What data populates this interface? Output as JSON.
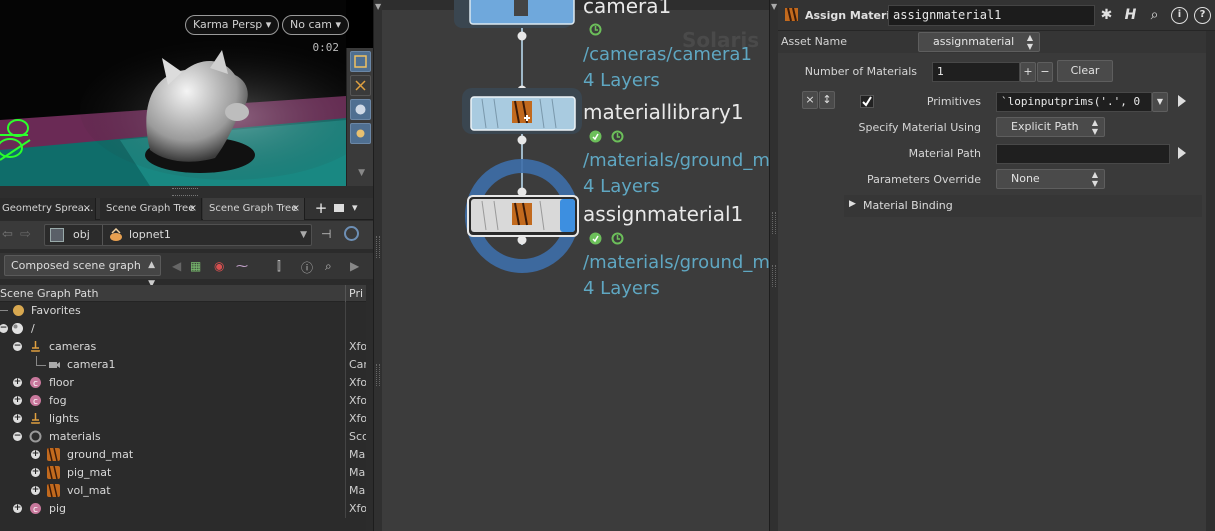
{
  "viewport": {
    "camera_menu": "Karma Persp",
    "cam_menu": "No cam",
    "time_readout": "0:02"
  },
  "tabs": [
    {
      "label": "Geometry Sprea...",
      "active": false
    },
    {
      "label": "Scene Graph Tree",
      "active": false
    },
    {
      "label": "Scene Graph Tree",
      "active": true
    }
  ],
  "path": {
    "level1": "obj",
    "level2": "lopnet1"
  },
  "scene_graph": {
    "mode": "Composed scene graph",
    "header_path": "Scene Graph Path",
    "header_primtype": "Pri",
    "rows": [
      {
        "label": "Favorites",
        "type": "",
        "icon": "favorites-icon"
      },
      {
        "label": "/",
        "type": "",
        "icon": "root-icon"
      },
      {
        "label": "cameras",
        "type": "Xfo",
        "icon": "xform-icon"
      },
      {
        "label": "camera1",
        "type": "Car",
        "icon": "camera-icon"
      },
      {
        "label": "floor",
        "type": "Xfo",
        "icon": "component-icon"
      },
      {
        "label": "fog",
        "type": "Xfo",
        "icon": "component-icon"
      },
      {
        "label": "lights",
        "type": "Xfo",
        "icon": "xform-icon"
      },
      {
        "label": "materials",
        "type": "Sco",
        "icon": "scope-icon"
      },
      {
        "label": "ground_mat",
        "type": "Ma",
        "icon": "material-icon"
      },
      {
        "label": "pig_mat",
        "type": "Ma",
        "icon": "material-icon"
      },
      {
        "label": "vol_mat",
        "type": "Ma",
        "icon": "material-icon"
      },
      {
        "label": "pig",
        "type": "Xfo",
        "icon": "component-icon"
      }
    ]
  },
  "network": {
    "watermark": "Solaris",
    "nodes": [
      {
        "name": "camera1",
        "path": "/cameras/camera1",
        "layers": "4 Layers"
      },
      {
        "name": "materiallibrary1",
        "path": "/materials/ground_ma",
        "layers": "4 Layers"
      },
      {
        "name": "assignmaterial1",
        "path": "/materials/ground_ma",
        "layers": "4 Layers"
      }
    ]
  },
  "params": {
    "node_type": "Assign Material",
    "node_name": "assignmaterial1",
    "asset_name_label": "Asset Name",
    "asset_name_value": "assignmaterial",
    "num_materials_label": "Number of Materials",
    "num_materials_value": "1",
    "add_btn": "+",
    "remove_btn": "−",
    "clear_btn": "Clear",
    "multiparm_remove": "×",
    "multiparm_reorder": "↕",
    "primitives_label": "Primitives",
    "primitives_value": "`lopinputprims('.', 0",
    "specify_label": "Specify Material Using",
    "specify_value": "Explicit Path",
    "material_path_label": "Material Path",
    "material_path_value": "",
    "params_override_label": "Parameters Override",
    "params_override_value": "None",
    "material_binding_label": "Material Binding"
  },
  "colors": {
    "accent_blue": "#5fa7c2",
    "node_blue": "#a9cbe0",
    "selected_ring": "#3d6ea8",
    "flag_green": "#6cbf5a"
  }
}
